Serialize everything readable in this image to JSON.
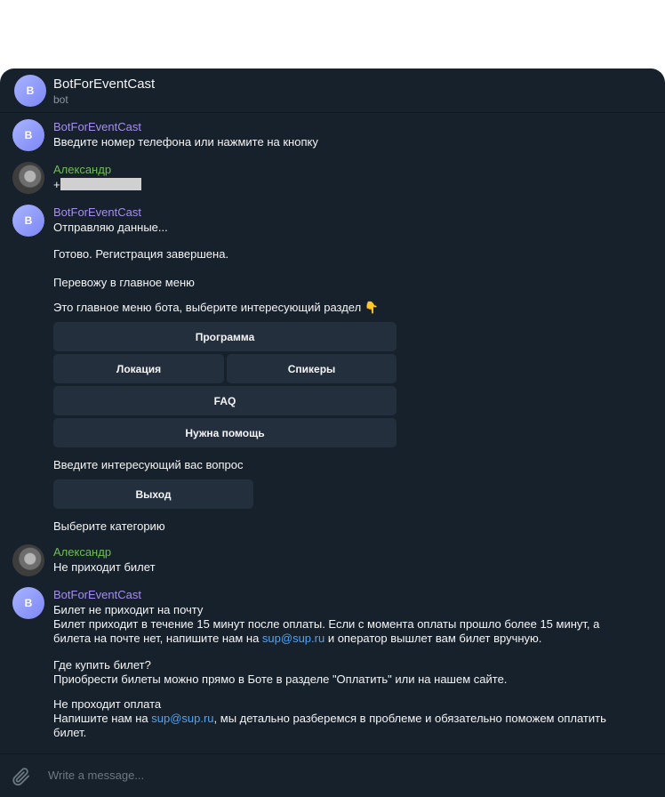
{
  "header": {
    "title": "BotForEventCast",
    "subtitle": "bot",
    "avatar_letter": "B"
  },
  "messages": {
    "m1": {
      "sender": "BotForEventCast",
      "avatar_letter": "B",
      "text": "Введите номер телефона или нажмите на кнопку"
    },
    "m2": {
      "sender": "Александр",
      "text_prefix": "+"
    },
    "m3": {
      "sender": "BotForEventCast",
      "avatar_letter": "B",
      "line1": "Отправляю данные...",
      "line2": "Готово. Регистрация завершена.",
      "line3": "Перевожу в главное меню",
      "line4": "Это главное меню бота, выберите интересующий раздел 👇",
      "keyboard": {
        "program": "Программа",
        "location": "Локация",
        "speakers": "Спикеры",
        "faq": "FAQ",
        "help": "Нужна помощь"
      },
      "line5": "Введите интересующий вас вопрос",
      "exit_button": "Выход",
      "line6": "Выберите категорию"
    },
    "m4": {
      "sender": "Александр",
      "text": "Не приходит билет"
    },
    "m5": {
      "sender": "BotForEventCast",
      "avatar_letter": "B",
      "p1_title": "Билет не приходит на почту",
      "p1_line1": "Билет приходит в течение 15 минут после оплаты. Если с момента оплаты прошло более 15 минут, а",
      "p1_line2_a": "билета на почте нет, напишите нам на ",
      "p1_link": "sup@sup.ru",
      "p1_line2_b": " и оператор вышлет вам билет вручную.",
      "p2_title": "Где купить билет?",
      "p2_line1": "Приобрести билеты можно прямо в Боте в разделе \"Оплатить\" или на нашем сайте.",
      "p3_title": "Не проходит оплата",
      "p3_line1_a": "Напишите нам на ",
      "p3_link": "sup@sup.ru",
      "p3_line1_b": ", мы детально разберемся в проблеме и обязательно поможем оплатить",
      "p3_line2": "билет."
    }
  },
  "composer": {
    "placeholder": "Write a message..."
  },
  "colors": {
    "background": "#17212b",
    "button": "#242f3d",
    "bot_name": "#a48ef0",
    "user_name": "#6fbe54",
    "link": "#4ea4f6"
  }
}
